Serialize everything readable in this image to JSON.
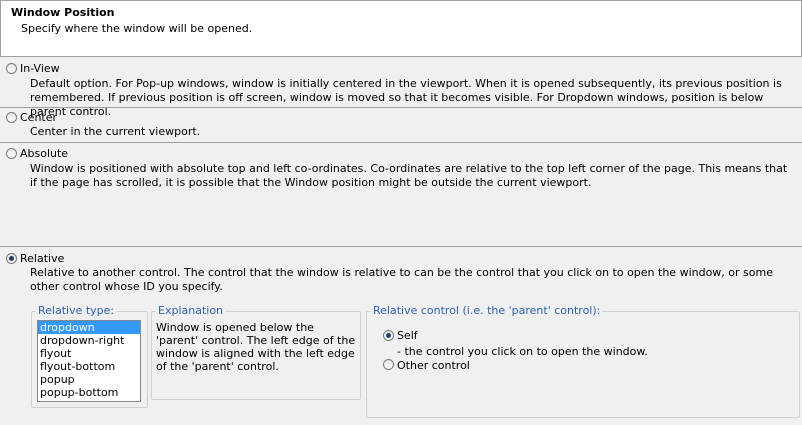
{
  "header": {
    "title": "Window Position",
    "subtitle": "Specify where the window will be opened."
  },
  "options": [
    {
      "label": "In-View",
      "description": "Default option. For Pop-up windows, window is initially centered in the viewport. When it is opened subsequently, its previous position is remembered. If previous position is off screen, window is moved so that it becomes visible. For Dropdown windows, position is below parent control.",
      "checked": false
    },
    {
      "label": "Center",
      "description": "Center in the current viewport.",
      "checked": false
    },
    {
      "label": "Absolute",
      "description": "Window is positioned with absolute top and left co-ordinates. Co-ordinates are relative to the top left corner of the page. This means that if the page has scrolled, it is possible that the Window position might be outside the current viewport.",
      "checked": false
    },
    {
      "label": "Relative",
      "description": "Relative to another control. The control that the window is relative to can be the control that you click on to open the window, or some other control whose ID you specify.",
      "checked": true
    }
  ],
  "relative_type": {
    "legend": "Relative type:",
    "items": [
      "dropdown",
      "dropdown-right",
      "flyout",
      "flyout-bottom",
      "popup",
      "popup-bottom"
    ],
    "selected": "dropdown"
  },
  "explanation": {
    "legend": "Explanation",
    "text": "Window is opened below the 'parent' control. The left edge of the window is aligned with the left edge of the 'parent' control."
  },
  "relative_control": {
    "legend": "Relative control (i.e. the 'parent' control):",
    "self_label": "Self",
    "self_desc": "- the control you click on to open the window.",
    "other_label": "Other control",
    "selected": "Self"
  }
}
